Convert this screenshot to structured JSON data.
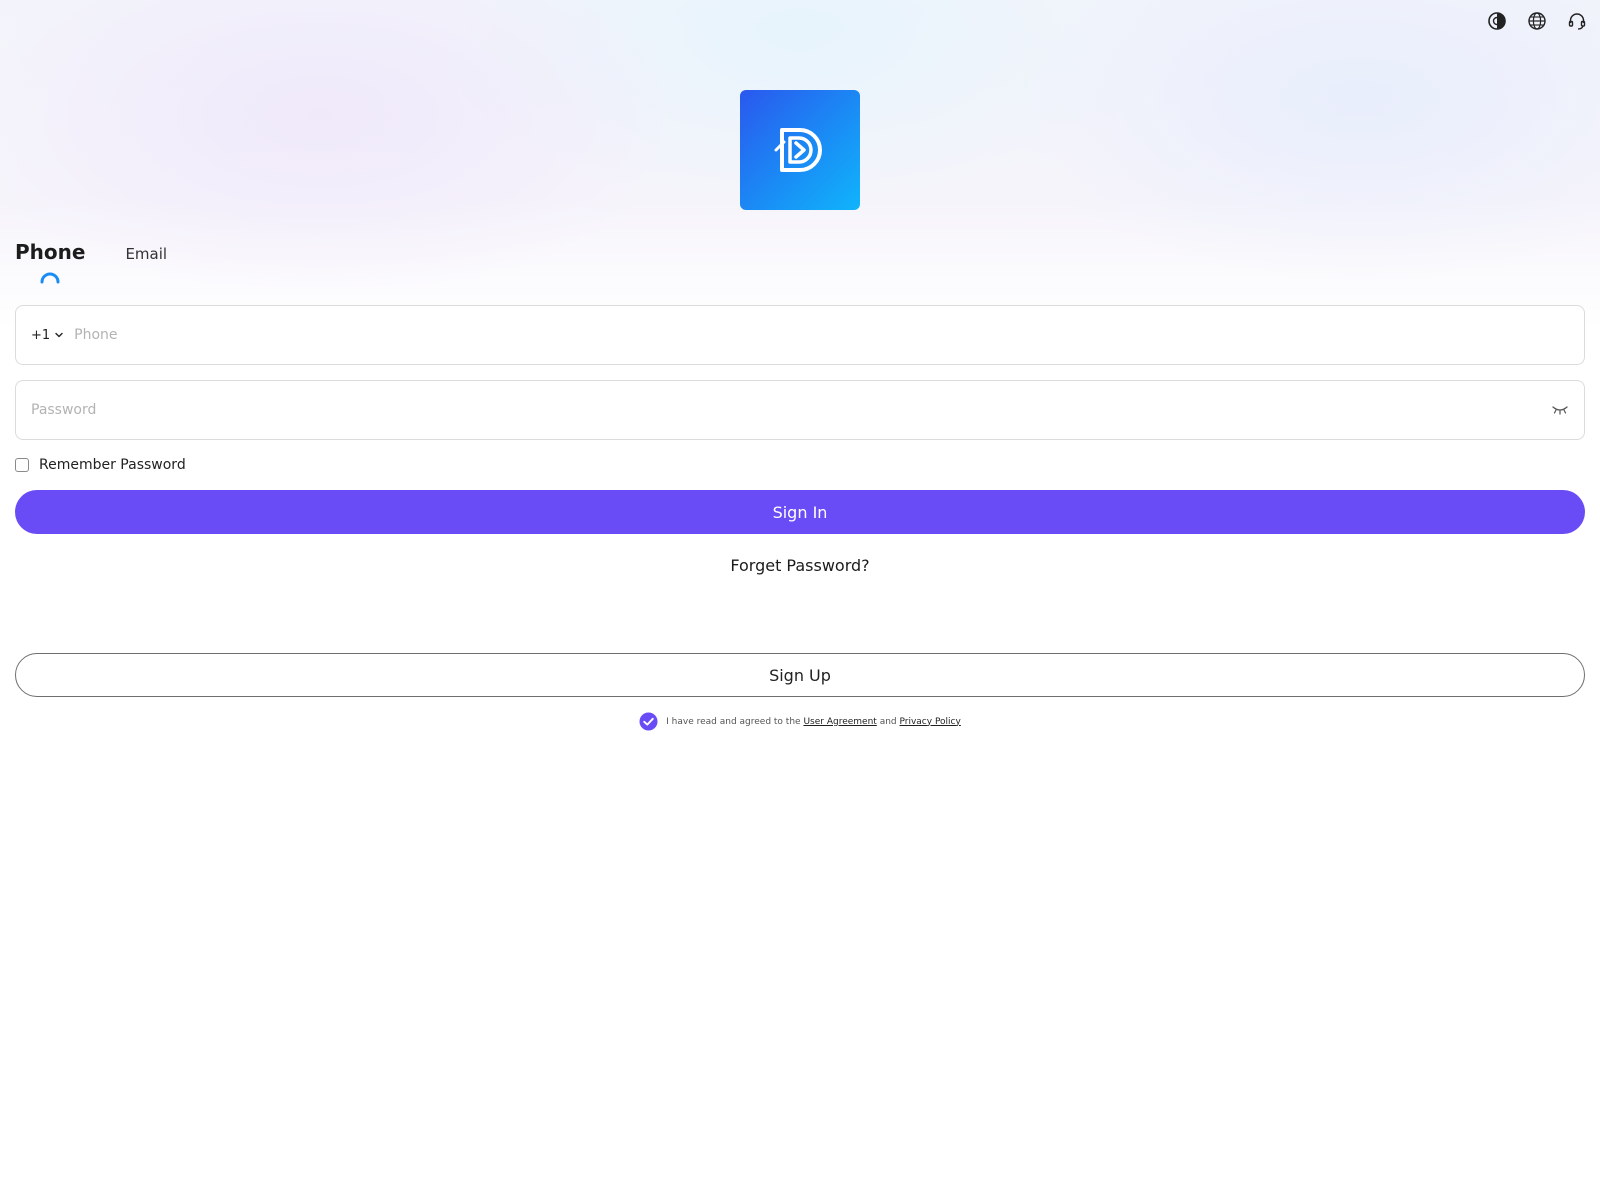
{
  "header": {
    "icons": [
      "contrast-icon",
      "globe-icon",
      "headset-icon"
    ]
  },
  "logo": {
    "letter": "D",
    "colors": [
      "#2a58ee",
      "#10b4fb"
    ]
  },
  "tabs": [
    {
      "label": "Phone",
      "active": true
    },
    {
      "label": "Email",
      "active": false
    }
  ],
  "phone": {
    "country_code": "+1",
    "placeholder": "Phone",
    "value": ""
  },
  "password": {
    "placeholder": "Password",
    "value": ""
  },
  "remember": {
    "label": "Remember Password",
    "checked": false
  },
  "signin": {
    "label": "Sign In",
    "color": "#6a4cf6"
  },
  "forget": {
    "label": "Forget Password?"
  },
  "signup": {
    "label": "Sign Up"
  },
  "agreement": {
    "checked": true,
    "text_before": "I have read and agreed to the",
    "user_agreement": "User Agreement",
    "and": "and",
    "privacy_policy": "Privacy Policy"
  },
  "colors": {
    "accent": "#6a4cf6",
    "tab_indicator": "#1a8cf5"
  }
}
